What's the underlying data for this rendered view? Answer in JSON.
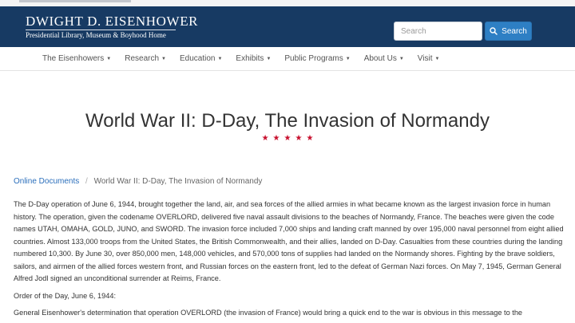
{
  "header": {
    "title": "Dwight D. Eisenhower",
    "subtitle": "Presidential Library, Museum & Boyhood Home",
    "search_placeholder": "Search",
    "search_button_label": "Search",
    "background_color": "#173a63",
    "search_button_color": "#2e7fc4"
  },
  "nav": {
    "items": [
      {
        "label": "The Eisenhowers"
      },
      {
        "label": "Research"
      },
      {
        "label": "Education"
      },
      {
        "label": "Exhibits"
      },
      {
        "label": "Public Programs"
      },
      {
        "label": "About Us"
      },
      {
        "label": "Visit"
      }
    ]
  },
  "page": {
    "title": "World War II: D-Day, The Invasion of Normandy",
    "stars": "★★★★★",
    "star_color": "#c8102e"
  },
  "breadcrumb": {
    "parent": "Online Documents",
    "separator": "/",
    "current": "World War II: D-Day, The Invasion of Normandy"
  },
  "content": {
    "paragraphs": [
      "The D-Day operation of June 6, 1944, brought together the land, air, and sea forces of the allied armies in what became known as the largest invasion force in human history. The operation, given the codename OVERLORD, delivered five naval assault divisions to the beaches of Normandy, France. The beaches were given the code names UTAH, OMAHA, GOLD, JUNO, and SWORD. The invasion force included 7,000 ships and landing craft manned by over 195,000 naval personnel from eight allied countries. Almost 133,000 troops from the United States, the British Commonwealth, and their allies, landed on D-Day. Casualties from these countries during the landing numbered 10,300. By June 30, over 850,000 men, 148,000 vehicles, and 570,000 tons of supplies had landed on the Normandy shores. Fighting by the brave soldiers, sailors, and airmen of the allied forces western front, and Russian forces on the eastern front, led to the defeat of German Nazi forces. On May 7, 1945, German General Alfred Jodl signed an unconditional surrender at Reims, France.",
      "Order of the Day, June 6, 1944:",
      "General Eisenhower's determination that operation OVERLORD (the invasion of France) would bring a quick end to the war is obvious in this message to the"
    ]
  }
}
